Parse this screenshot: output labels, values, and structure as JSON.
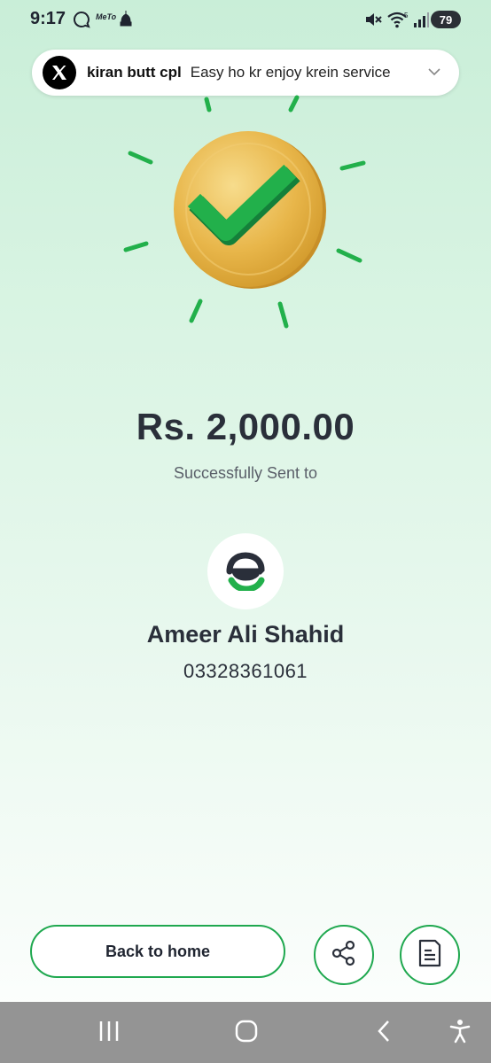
{
  "status_bar": {
    "time": "9:17",
    "app_icons": [
      "chat-bubble-icon",
      "meto-icon",
      "mosque-icon"
    ],
    "right_icons": [
      "mute-icon",
      "wifi-icon",
      "signal-icon"
    ],
    "battery": "79",
    "meto_label": "MeTo"
  },
  "notification": {
    "app_icon": "x-logo-icon",
    "title": "kiran butt cpl",
    "text": "Easy ho kr enjoy krein service"
  },
  "transaction": {
    "amount": "Rs. 2,000.00",
    "subtitle": "Successfully Sent to"
  },
  "recipient": {
    "name": "Ameer Ali Shahid",
    "number": "03328361061",
    "avatar_icon": "easypaisa-logo-icon"
  },
  "actions": {
    "back_label": "Back to home",
    "share_icon": "share-icon",
    "receipt_icon": "receipt-icon"
  },
  "nav_bar": {
    "items": [
      "recent-apps-icon",
      "home-icon",
      "back-icon",
      "accessibility-icon"
    ]
  },
  "colors": {
    "accent": "#1fa84f",
    "coin": "#e8b64a",
    "check": "#22b04b"
  }
}
